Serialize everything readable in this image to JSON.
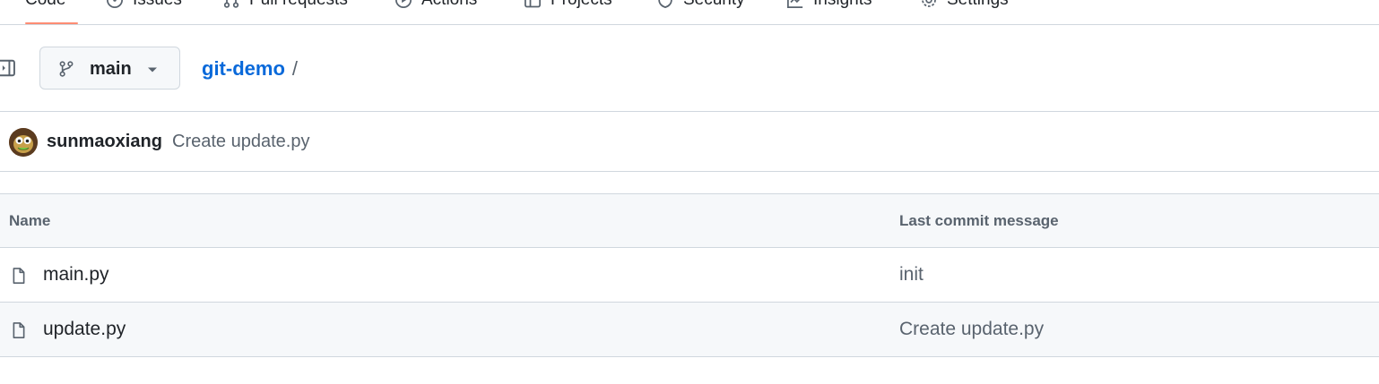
{
  "repo_nav": {
    "tabs": [
      {
        "label": "Code",
        "icon": "code-icon",
        "active": true
      },
      {
        "label": "Issues",
        "icon": "issue-icon"
      },
      {
        "label": "Pull requests",
        "icon": "pull-request-icon"
      },
      {
        "label": "Actions",
        "icon": "play-icon"
      },
      {
        "label": "Projects",
        "icon": "table-icon"
      },
      {
        "label": "Security",
        "icon": "shield-icon"
      },
      {
        "label": "Insights",
        "icon": "graph-icon"
      },
      {
        "label": "Settings",
        "icon": "gear-icon"
      }
    ]
  },
  "branch": {
    "name": "main"
  },
  "breadcrumb": {
    "repo": "git-demo",
    "separator": "/"
  },
  "latest_commit": {
    "author": "sunmaoxiang",
    "message": "Create update.py"
  },
  "file_table": {
    "headers": {
      "name": "Name",
      "last_commit": "Last commit message"
    },
    "rows": [
      {
        "name": "main.py",
        "commit_message": "init"
      },
      {
        "name": "update.py",
        "commit_message": "Create update.py"
      }
    ]
  },
  "colors": {
    "link": "#0969da",
    "active_tab_underline": "#fd8c73",
    "border": "#d0d7de",
    "muted_text": "#59636e"
  }
}
